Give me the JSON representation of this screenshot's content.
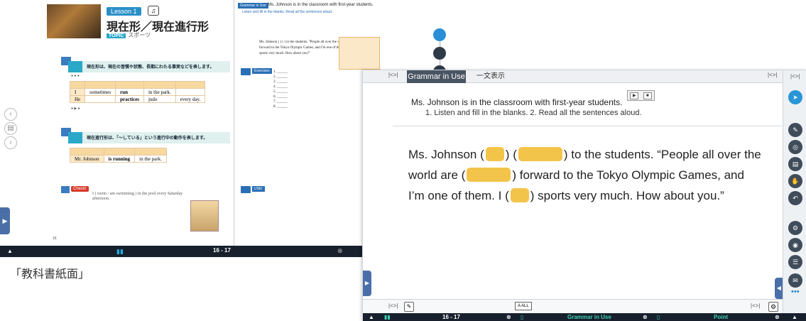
{
  "textbook": {
    "lesson_badge": "Lesson 1",
    "title": "現在形／現在進行形",
    "topic_tag": "TOPIC",
    "topic": "スポーツ",
    "point1_num": "1",
    "point1": "現在形は、現在の習慣や状態、長期にわたる事実などを表します。",
    "point2_num": "2",
    "point2": "現在進行形は、「〜している」という進行中の動作を表します。",
    "table1": [
      [
        "I",
        "sometimes",
        "run",
        "in the park."
      ],
      [
        "He",
        "",
        "practices",
        "judo",
        "every day."
      ]
    ],
    "table2": [
      [
        "Mr. Johnson",
        "is running",
        "in the park."
      ]
    ],
    "check": "Check!",
    "check_q1": "I ( swim / am swimming ) in the pool every Saturday afternoon.",
    "grammar_tag": "Grammar in Use",
    "grammar_text": "Ms. Johnson is in the classroom with first-year students.",
    "grammar_sub": "Listen and fill in the blanks.   Read all the sentences aloud.",
    "passage": "Ms. Johnson (  ) (  ) to the students. \"People all over the world are (  ) forward to the Tokyo Olympic Games, and I'm one of them. I (  ) sports very much. How about you?\"",
    "exercises_tag": "Exercises",
    "use_tag": "USE!",
    "page_numbers": "16 - 17",
    "left_page_no": "16"
  },
  "caption": "「教科書紙面」",
  "app": {
    "tab_nav": "|<>|",
    "tab_active": "Grammar in Use",
    "tab_second": "一文表示",
    "intro": "Ms. Johnson is in the classroom with first-year students.",
    "play_icon": "▶",
    "stop_icon": "■",
    "instructions": "1. Listen and fill in the blanks.    2. Read all the sentences aloud.",
    "text": {
      "p1": "Ms. Johnson",
      "p2": "to the students.  “People",
      "p3": "all over the world are",
      "p4": "forward to the Tokyo",
      "p5": "Olympic Games, and I’m one of them.  I",
      "p6": "sports",
      "p7": "very much.  How about you.”"
    },
    "all_button": "A ALL",
    "footer": {
      "pages": "16 - 17",
      "grammar": "Grammar in Use",
      "point": "Point"
    }
  },
  "colors": {
    "blank": "#f3c44a",
    "tab_active": "#4a5563",
    "accent": "#2a95d6",
    "footer": "#17202c"
  }
}
